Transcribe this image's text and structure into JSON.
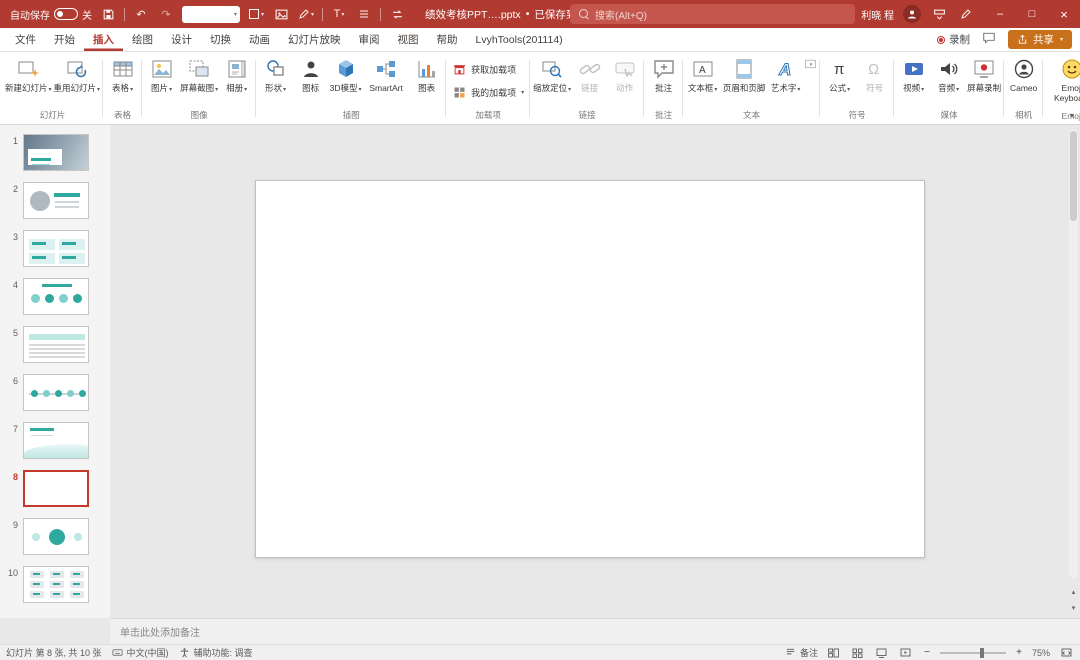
{
  "titlebar": {
    "autosave_label": "自动保存",
    "autosave_state": "关",
    "doc_title": "绩效考核PPT….pptx",
    "dot": "•",
    "save_status": "已保存到这台电脑",
    "search_placeholder": "搜索(Alt+Q)",
    "user_name": "利晓 程"
  },
  "tabs": {
    "items": [
      {
        "label": "文件"
      },
      {
        "label": "开始"
      },
      {
        "label": "插入"
      },
      {
        "label": "绘图"
      },
      {
        "label": "设计"
      },
      {
        "label": "切换"
      },
      {
        "label": "动画"
      },
      {
        "label": "幻灯片放映"
      },
      {
        "label": "审阅"
      },
      {
        "label": "视图"
      },
      {
        "label": "帮助"
      },
      {
        "label": "LvyhTools(201114)"
      }
    ],
    "record_label": "录制",
    "share_label": "共享"
  },
  "ribbon": {
    "groups": [
      {
        "label": "幻灯片",
        "items": [
          {
            "label": "新建幻灯片"
          },
          {
            "label": "重用幻灯片"
          }
        ]
      },
      {
        "label": "表格",
        "items": [
          {
            "label": "表格"
          }
        ]
      },
      {
        "label": "图像",
        "items": [
          {
            "label": "图片"
          },
          {
            "label": "屏幕截图"
          },
          {
            "label": "相册"
          }
        ]
      },
      {
        "label": "插图",
        "items": [
          {
            "label": "形状"
          },
          {
            "label": "图标"
          },
          {
            "label": "3D模型"
          },
          {
            "label": "SmartArt"
          },
          {
            "label": "图表"
          }
        ]
      },
      {
        "label": "加载项",
        "items": [
          {
            "label": "获取加载项"
          },
          {
            "label": "我的加载项"
          }
        ]
      },
      {
        "label": "链接",
        "items": [
          {
            "label": "缩放定位"
          },
          {
            "label": "链接"
          },
          {
            "label": "动作"
          }
        ]
      },
      {
        "label": "批注",
        "items": [
          {
            "label": "批注"
          }
        ]
      },
      {
        "label": "文本",
        "items": [
          {
            "label": "文本框"
          },
          {
            "label": "页眉和页脚"
          },
          {
            "label": "艺术字"
          }
        ]
      },
      {
        "label": "符号",
        "items": [
          {
            "label": "公式"
          },
          {
            "label": "符号"
          }
        ]
      },
      {
        "label": "媒体",
        "items": [
          {
            "label": "视频"
          },
          {
            "label": "音频"
          },
          {
            "label": "屏幕录制"
          }
        ]
      },
      {
        "label": "相机",
        "items": [
          {
            "label": "Cameo"
          }
        ]
      },
      {
        "label": "Emoji",
        "items": [
          {
            "label": "Emoji Keyboard"
          }
        ]
      }
    ]
  },
  "slides": {
    "selected": 8,
    "items": [
      {
        "num": "1"
      },
      {
        "num": "2"
      },
      {
        "num": "3"
      },
      {
        "num": "4"
      },
      {
        "num": "5"
      },
      {
        "num": "6"
      },
      {
        "num": "7"
      },
      {
        "num": "8"
      },
      {
        "num": "9"
      },
      {
        "num": "10"
      }
    ]
  },
  "notes": {
    "placeholder": "单击此处添加备注"
  },
  "statusbar": {
    "slide_info": "幻灯片 第 8 张, 共 10 张",
    "language": "中文(中国)",
    "accessibility": "辅助功能: 调查",
    "notes_label": "备注",
    "zoom_percent": "75%"
  },
  "colors": {
    "accent_red": "#b13a31",
    "share_orange": "#c9701a",
    "theme_teal": "#2fa8a0"
  }
}
